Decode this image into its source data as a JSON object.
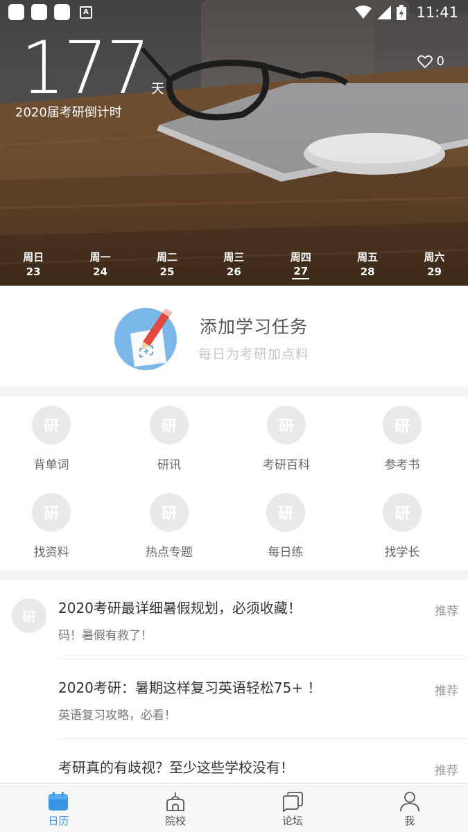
{
  "status_bar": {
    "time": "11:41",
    "notification_icons": [
      "app-notification-icon",
      "app-notification-icon",
      "app-notification-icon",
      "accessibility-icon"
    ]
  },
  "hero": {
    "countdown_days": "177",
    "countdown_unit": "天",
    "countdown_caption": "2020届考研倒计时",
    "like_count": "0",
    "week": [
      {
        "name": "周日",
        "date": "23"
      },
      {
        "name": "周一",
        "date": "24"
      },
      {
        "name": "周二",
        "date": "25"
      },
      {
        "name": "周三",
        "date": "26"
      },
      {
        "name": "周四",
        "date": "27",
        "active": true
      },
      {
        "name": "周五",
        "date": "28"
      },
      {
        "name": "周六",
        "date": "29"
      }
    ]
  },
  "task_card": {
    "title": "添加学习任务",
    "subtitle": "每日为考研加点料"
  },
  "grid": {
    "placeholder_glyph": "研",
    "items": [
      {
        "label": "背单词"
      },
      {
        "label": "研讯"
      },
      {
        "label": "考研百科"
      },
      {
        "label": "参考书"
      },
      {
        "label": "找资料"
      },
      {
        "label": "热点专题"
      },
      {
        "label": "每日练"
      },
      {
        "label": "找学长"
      }
    ]
  },
  "feed": {
    "avatar_glyph": "研",
    "articles": [
      {
        "title": "2020考研最详细暑假规划，必须收藏！",
        "subtitle": "码！暑假有救了！",
        "tag": "推荐"
      },
      {
        "title": "2020考研：暑期这样复习英语轻松75+ ！",
        "subtitle": "英语复习攻略，必看！",
        "tag": "推荐"
      },
      {
        "title": "考研真的有歧视？至少这些学校没有！",
        "subtitle": "",
        "tag": "推荐"
      }
    ]
  },
  "tabbar": {
    "accent_color": "#3b95e6",
    "tabs": [
      {
        "label": "日历",
        "icon": "calendar-icon",
        "active": true
      },
      {
        "label": "院校",
        "icon": "school-icon"
      },
      {
        "label": "论坛",
        "icon": "forum-icon"
      },
      {
        "label": "我",
        "icon": "person-icon"
      }
    ]
  }
}
